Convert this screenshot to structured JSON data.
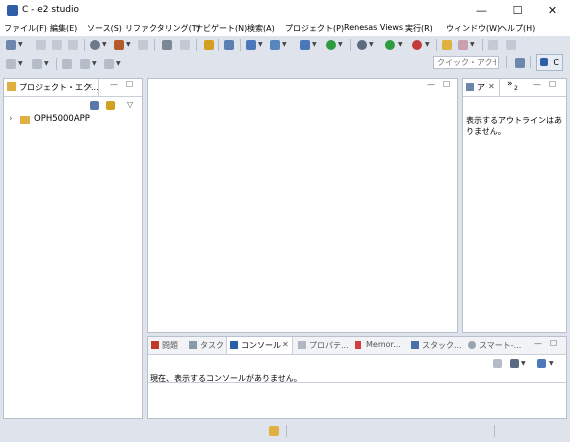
{
  "window": {
    "title": "C - e2 studio",
    "minimize": "—",
    "maximize": "☐",
    "close": "✕"
  },
  "menu": [
    "ファイル(F)",
    "編集(E)",
    "ソース(S)",
    "リファクタリング(T)",
    "ナビゲート(N)",
    "検索(A)",
    "プロジェクト(P)",
    "Renesas Views",
    "実行(R)",
    "ウィンドウ(W)",
    "ヘルプ(H)"
  ],
  "toolbar": {
    "quick_access_placeholder": "クイック・アクセス",
    "perspective_label": "C"
  },
  "project_explorer": {
    "tab_label": "プロジェクト・エク...",
    "close": "✕",
    "minimize": "—",
    "maximize": "☐",
    "menu": "▽",
    "expand": "›",
    "project_name": "OPH5000APP"
  },
  "outline": {
    "tab_label": "ア",
    "close": "✕",
    "overflow": "»",
    "overflow_count": "2",
    "minimize": "—",
    "maximize": "☐",
    "message": "表示するアウトラインはありません。"
  },
  "editor": {
    "minimize": "—",
    "maximize": "☐"
  },
  "bottom": {
    "tabs": [
      {
        "name": "tab-problems",
        "icon": "problems-icon",
        "label": "問題",
        "color": "#c0392b"
      },
      {
        "name": "tab-tasks",
        "icon": "tasks-icon",
        "label": "タスク",
        "color": "#8899aa"
      },
      {
        "name": "tab-console",
        "icon": "console-icon",
        "label": "コンソール",
        "color": "#2d5ea8"
      },
      {
        "name": "tab-properties",
        "icon": "properties-icon",
        "label": "プロパテ...",
        "color": "#b0b8c4"
      },
      {
        "name": "tab-memory",
        "icon": "memory-icon",
        "label": "Memor...",
        "color": "#d04040"
      },
      {
        "name": "tab-stack",
        "icon": "stack-icon",
        "label": "スタック...",
        "color": "#4a6fa5"
      },
      {
        "name": "tab-smart",
        "icon": "smart-icon",
        "label": "スマート-...",
        "color": "#9aa4b0"
      }
    ],
    "console_close": "✕",
    "minimize": "—",
    "maximize": "☐",
    "console_message": "現在、表示するコンソールがありません。"
  },
  "colors": {
    "accent": "#2d5ea8",
    "run_green": "#2e9b3e",
    "debug_green": "#3aa14a",
    "folder": "#e0b040"
  }
}
